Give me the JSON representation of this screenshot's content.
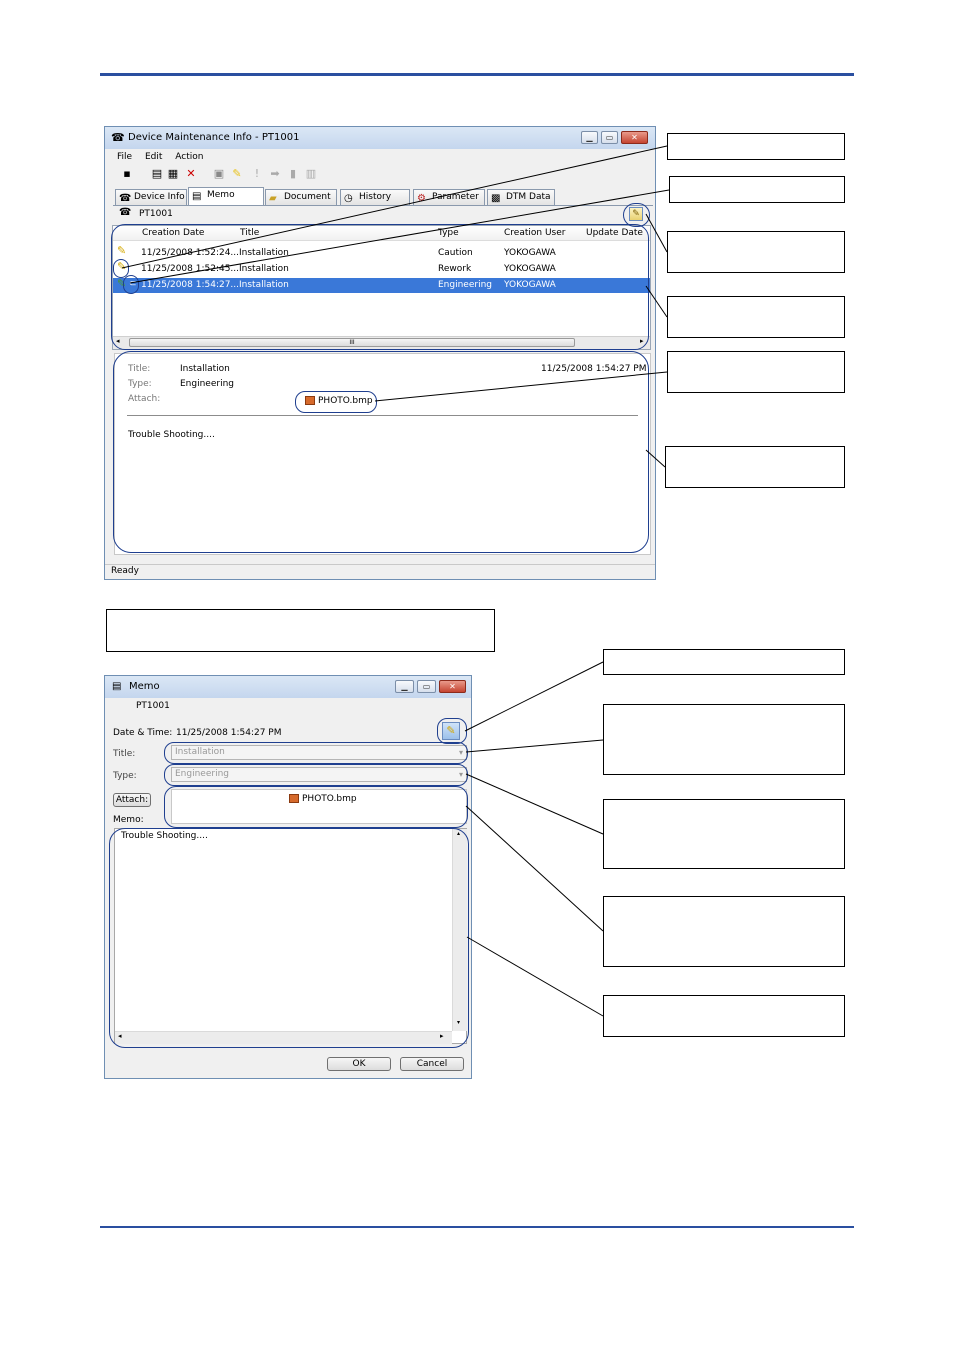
{
  "main_window": {
    "title": "Device Maintenance Info - PT1001",
    "menu": [
      "File",
      "Edit",
      "Action"
    ],
    "tabs": [
      "Device Info",
      "Memo",
      "Document",
      "History",
      "Parameter",
      "DTM Data"
    ],
    "device": "PT1001",
    "columns": [
      "Creation Date",
      "Title",
      "Type",
      "Creation User",
      "Update Date"
    ],
    "rows": [
      {
        "date": "11/25/2008 1:52:24...",
        "title": "Installation",
        "type": "Caution",
        "user": "YOKOGAWA"
      },
      {
        "date": "11/25/2008 1:52:45...",
        "title": "Installation",
        "type": "Rework",
        "user": "YOKOGAWA"
      },
      {
        "date": "11/25/2008 1:54:27...",
        "title": "Installation",
        "type": "Engineering",
        "user": "YOKOGAWA"
      }
    ],
    "detail": {
      "title_label": "Title:",
      "title_value": "Installation",
      "type_label": "Type:",
      "type_value": "Engineering",
      "attach_label": "Attach:",
      "attachment": "PHOTO.bmp",
      "datetime": "11/25/2008 1:54:27 PM",
      "memo": "Trouble Shooting...."
    },
    "status": "Ready"
  },
  "memo_dialog": {
    "title": "Memo",
    "device": "PT1001",
    "datetime_label": "Date & Time:",
    "datetime": "11/25/2008 1:54:27 PM",
    "title_label": "Title:",
    "title_value": "Installation",
    "type_label": "Type:",
    "type_value": "Engineering",
    "attach_button": "Attach:",
    "attachment": "PHOTO.bmp",
    "memo_label": "Memo:",
    "memo_text": "Trouble Shooting....",
    "ok": "OK",
    "cancel": "Cancel"
  },
  "icons": {
    "window": "device-maintenance-icon",
    "toolbar": [
      "save-icon",
      "new-memo-icon",
      "properties-icon",
      "delete-icon",
      "image-icon",
      "pin-icon",
      "caution-icon",
      "forward-icon",
      "document-icon",
      "compare-icon"
    ],
    "pin_color": "#e8c21a"
  }
}
